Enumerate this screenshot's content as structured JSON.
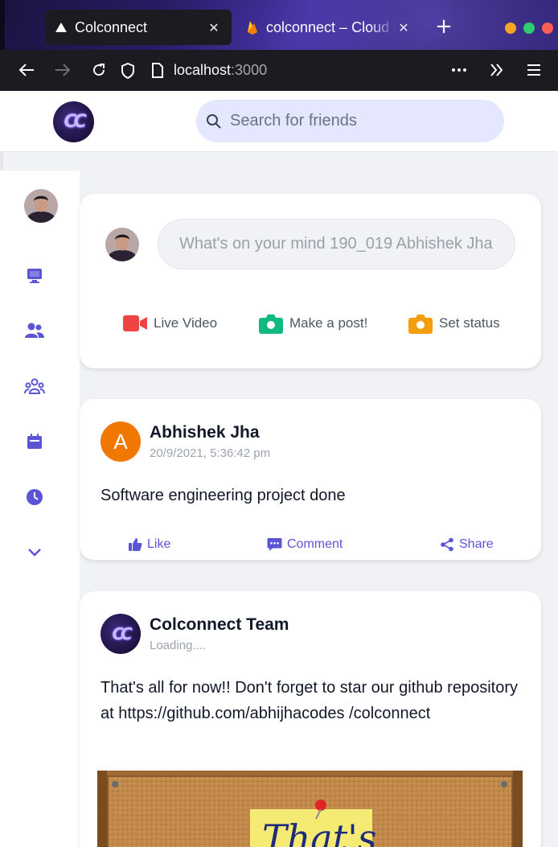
{
  "browser": {
    "tabs": [
      {
        "title": "Colconnect",
        "favicon": "vercel-triangle-icon",
        "active": true
      },
      {
        "title": "colconnect – Cloud Firestore",
        "favicon": "firebase-flame-icon",
        "active": false
      }
    ],
    "url_host": "localhost",
    "url_port": ":3000",
    "window_controls": {
      "minimize": "#f5a623",
      "maximize": "#2ecc71",
      "close": "#ff5f57"
    }
  },
  "header": {
    "logo_text": "CC",
    "search_placeholder": "Search for friends"
  },
  "sidebar": {
    "items": [
      {
        "name": "profile-avatar"
      },
      {
        "icon": "monitor-icon"
      },
      {
        "icon": "friends-icon"
      },
      {
        "icon": "groups-icon"
      },
      {
        "icon": "calendar-icon"
      },
      {
        "icon": "clock-icon"
      },
      {
        "icon": "chevron-down-icon"
      }
    ]
  },
  "composer": {
    "placeholder": "What's on your mind 190_019 Abhishek Jha",
    "actions": [
      {
        "label": "Live Video",
        "icon": "video-camera-icon",
        "color": "#ef4444"
      },
      {
        "label": "Make a post!",
        "icon": "camera-icon",
        "color": "#10b981"
      },
      {
        "label": "Set status",
        "icon": "camera-icon",
        "color": "#f59e0b"
      }
    ]
  },
  "posts": [
    {
      "avatar_letter": "A",
      "avatar_color": "#f07800",
      "author": "Abhishek Jha",
      "time": "20/9/2021, 5:36:42 pm",
      "text": "Software engineering project done",
      "actions": {
        "like": "Like",
        "comment": "Comment",
        "share": "Share"
      }
    },
    {
      "avatar_logo": "CC",
      "author": "Colconnect Team",
      "time": "Loading....",
      "text": "That's all for now!! Don't forget to star our github repository at https://github.com/abhijhacodes /colconnect",
      "image_caption": "That's"
    }
  ],
  "colors": {
    "accent": "#5b55d6",
    "search_bg": "#e4e7fd",
    "page_bg": "#f0f2f5"
  }
}
